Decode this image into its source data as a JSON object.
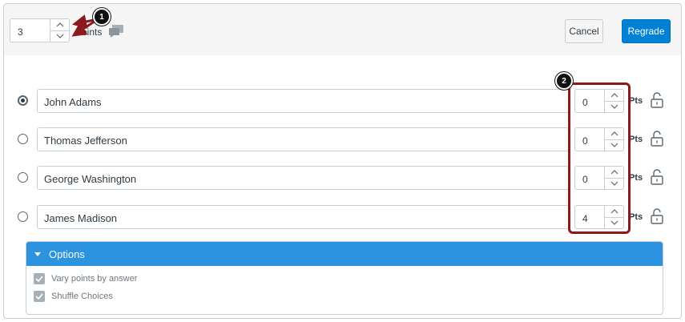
{
  "header": {
    "points_value": "3",
    "points_label": "Points",
    "cancel_label": "Cancel",
    "regrade_label": "Regrade"
  },
  "answers": [
    {
      "text": "John Adams",
      "points": "0",
      "selected": true
    },
    {
      "text": "Thomas Jefferson",
      "points": "0",
      "selected": false
    },
    {
      "text": "George Washington",
      "points": "0",
      "selected": false
    },
    {
      "text": "James Madison",
      "points": "4",
      "selected": false
    }
  ],
  "pts_label": "Pts",
  "callouts": [
    "1",
    "2"
  ],
  "options": {
    "title": "Options",
    "items": [
      {
        "label": "Vary points by answer",
        "checked": true
      },
      {
        "label": "Shuffle Choices",
        "checked": true
      }
    ]
  },
  "colors": {
    "accent": "#0081d6",
    "options_header": "#2b93e0",
    "annotation": "#8b1a1f"
  },
  "icons": [
    "chevron-up-icon",
    "chevron-down-icon",
    "comment-icon",
    "unlock-icon",
    "checkmark-icon",
    "caret-down-icon"
  ]
}
